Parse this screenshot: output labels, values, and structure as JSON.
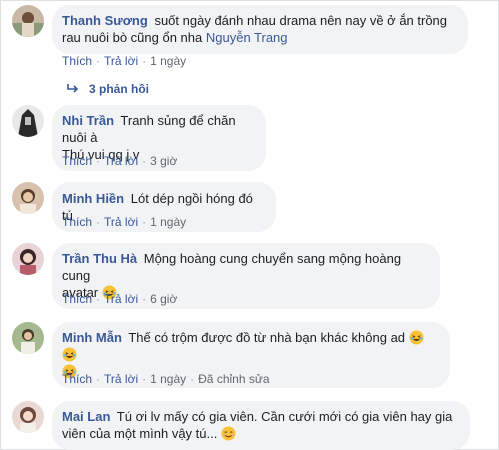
{
  "comments": [
    {
      "author": "Thanh Sương",
      "line1": "suốt ngày đánh nhau drama nên nay về ở ắn trồng",
      "line2": "rau nuôi bò cũng ổn nha",
      "mention": "Nguyễn Trang",
      "like": "Thích",
      "reply": "Trả lời",
      "time": "1 ngày",
      "replies": "3 phản hồi"
    },
    {
      "author": "Nhi Trần",
      "line1": "Tranh sủng để chăn nuôi à",
      "line2": "Thú vui qq j v",
      "like": "Thích",
      "reply": "Trả lời",
      "time": "3 giờ"
    },
    {
      "author": "Minh Hiền",
      "line1": "Lót dép ngồi hóng đó tú",
      "like": "Thích",
      "reply": "Trả lời",
      "time": "1 ngày"
    },
    {
      "author": "Trần Thu Hà",
      "line1": "Mộng hoàng cung chuyển sang mộng hoàng cung",
      "line2": "avatar",
      "like": "Thích",
      "reply": "Trả lời",
      "time": "6 giờ"
    },
    {
      "author": "Minh Mẫn",
      "line1": "Thế có trộm được đồ từ nhà bạn khác không ad",
      "like": "Thích",
      "reply": "Trả lời",
      "time": "1 ngày",
      "edited": "Đã chỉnh sửa"
    },
    {
      "author": "Mai Lan",
      "line1": "Tú ơi lv mấy có gia viên. Cần cưới mới có gia viên hay gia",
      "line2": "viên của một mình vậy tú..."
    }
  ],
  "icons": {
    "laugh": "laughing-emoji-icon",
    "smile": "smiling-emoji-icon",
    "reply_arrow": "reply-arrow-icon"
  },
  "colors": {
    "link": "#385898",
    "bubble": "#f2f3f5",
    "meta": "#616770"
  }
}
